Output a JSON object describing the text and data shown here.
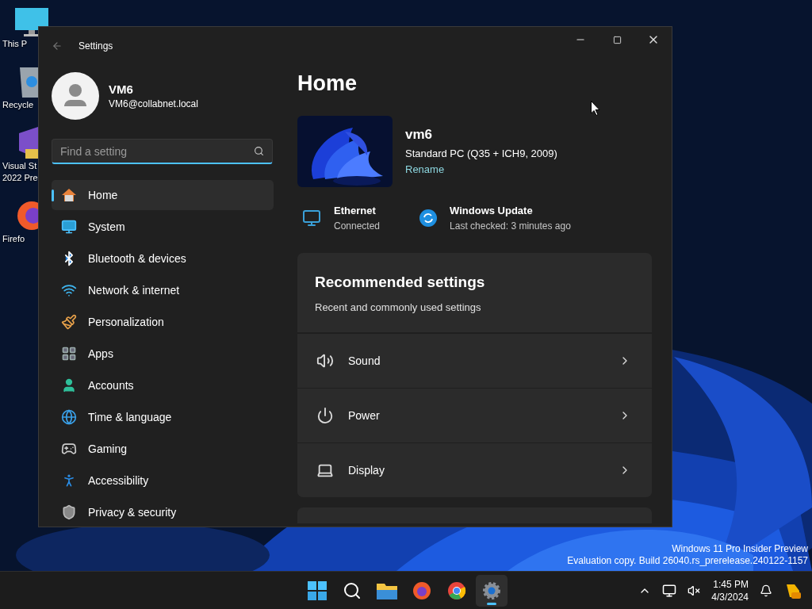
{
  "desktop": {
    "icons": [
      {
        "kind": "monitor",
        "lines": [
          "This P"
        ]
      },
      {
        "kind": "recycle",
        "lines": [
          "Recycle"
        ]
      },
      {
        "kind": "studio",
        "lines": [
          "Visual St",
          "2022 Pre"
        ]
      },
      {
        "kind": "firefox",
        "lines": [
          "Firefo"
        ]
      }
    ],
    "notice": [
      "Windows 11 Pro Insider Preview",
      "Evaluation copy. Build 26040.rs_prerelease.240122-1157"
    ]
  },
  "window": {
    "title": "Settings"
  },
  "profile": {
    "name": "VM6",
    "email": "VM6@collabnet.local"
  },
  "search": {
    "placeholder": "Find a setting"
  },
  "nav": [
    {
      "kind": "home",
      "label": "Home",
      "selected": true
    },
    {
      "kind": "system",
      "label": "System",
      "selected": false
    },
    {
      "kind": "bluetooth",
      "label": "Bluetooth & devices",
      "selected": false
    },
    {
      "kind": "network",
      "label": "Network & internet",
      "selected": false
    },
    {
      "kind": "personalization",
      "label": "Personalization",
      "selected": false
    },
    {
      "kind": "apps",
      "label": "Apps",
      "selected": false
    },
    {
      "kind": "accounts",
      "label": "Accounts",
      "selected": false
    },
    {
      "kind": "time",
      "label": "Time & language",
      "selected": false
    },
    {
      "kind": "gaming",
      "label": "Gaming",
      "selected": false
    },
    {
      "kind": "accessibility",
      "label": "Accessibility",
      "selected": false
    },
    {
      "kind": "privacy",
      "label": "Privacy & security",
      "selected": false
    }
  ],
  "page": {
    "title": "Home",
    "device": {
      "name": "vm6",
      "model": "Standard PC (Q35 + ICH9, 2009)",
      "rename": "Rename"
    },
    "status": [
      {
        "kind": "ethernet",
        "title": "Ethernet",
        "detail": "Connected"
      },
      {
        "kind": "update",
        "title": "Windows Update",
        "detail": "Last checked: 3 minutes ago"
      }
    ],
    "recommended": {
      "title": "Recommended settings",
      "subtitle": "Recent and commonly used settings",
      "items": [
        {
          "kind": "sound",
          "label": "Sound"
        },
        {
          "kind": "power",
          "label": "Power"
        },
        {
          "kind": "display",
          "label": "Display"
        }
      ]
    }
  },
  "taskbar": {
    "apps": [
      {
        "kind": "start",
        "selected": false
      },
      {
        "kind": "search",
        "selected": false
      },
      {
        "kind": "explorer",
        "selected": false
      },
      {
        "kind": "firefox",
        "selected": false
      },
      {
        "kind": "chrome",
        "selected": false
      },
      {
        "kind": "settings",
        "selected": true
      }
    ],
    "time": "1:45 PM",
    "date": "4/3/2024"
  }
}
